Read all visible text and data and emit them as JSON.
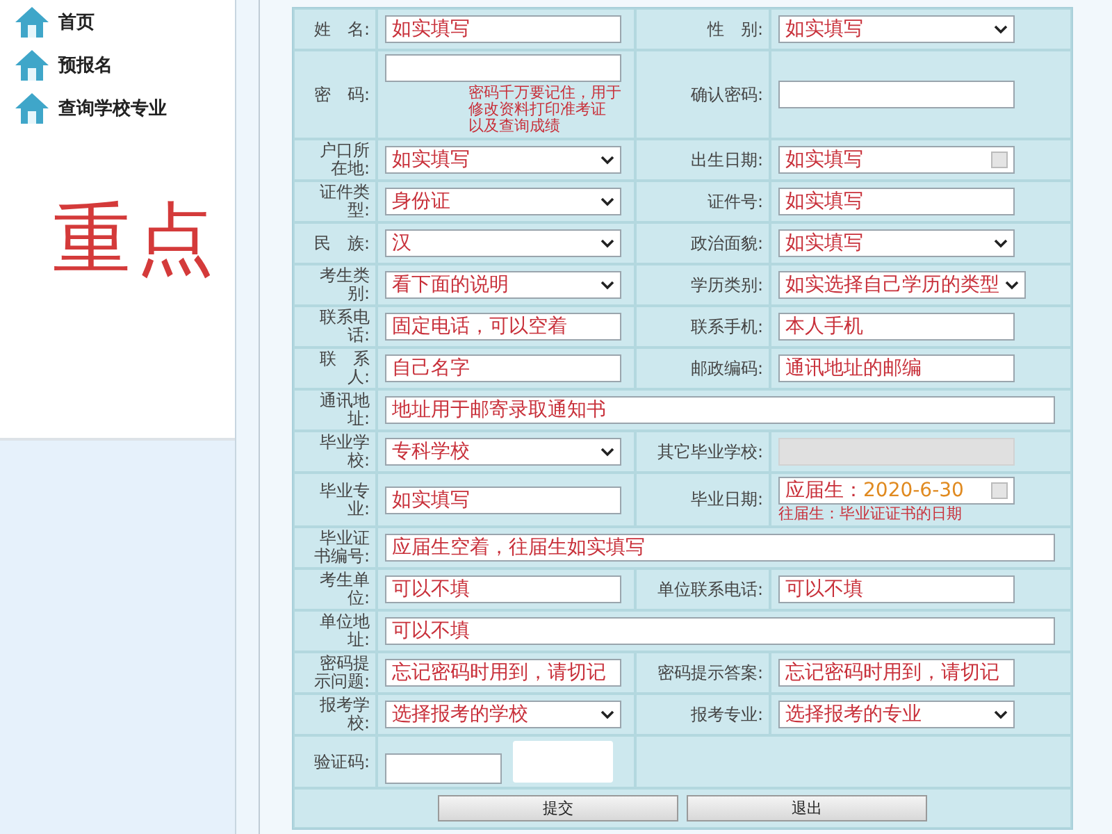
{
  "nav": [
    {
      "label": "首页"
    },
    {
      "label": "预报名"
    },
    {
      "label": "查询学校专业"
    }
  ],
  "stamp": "重点",
  "rows": [
    {
      "cells": [
        {
          "label": "姓　名:",
          "kind": "text",
          "value": "如实填写"
        },
        {
          "label": "性　别:",
          "kind": "select",
          "value": "如实填写"
        }
      ]
    },
    {
      "cells": [
        {
          "label": "密　码:",
          "kind": "text",
          "note": [
            "密码千万要记住，用于",
            "修改资料打印准考证",
            "以及查询成绩"
          ]
        },
        {
          "label": "确认密码:",
          "kind": "text"
        }
      ]
    },
    {
      "cells": [
        {
          "label": "户口所在地:",
          "kind": "select",
          "value": "如实填写"
        },
        {
          "label": "出生日期:",
          "kind": "date",
          "value": "如实填写"
        }
      ]
    },
    {
      "cells": [
        {
          "label": "证件类型:",
          "kind": "select",
          "value": "身份证"
        },
        {
          "label": "证件号:",
          "kind": "text",
          "value": "如实填写"
        }
      ]
    },
    {
      "cells": [
        {
          "label": "民　族:",
          "kind": "select",
          "value": "汉"
        },
        {
          "label": "政治面貌:",
          "kind": "select",
          "value": "如实填写"
        }
      ]
    },
    {
      "cells": [
        {
          "label": "考生类别:",
          "kind": "select",
          "value": "看下面的说明"
        },
        {
          "label": "学历类别:",
          "kind": "select",
          "value": "如实选择自己学历的类型"
        }
      ]
    },
    {
      "cells": [
        {
          "label": "联系电话:",
          "kind": "text",
          "value": "固定电话，可以空着"
        },
        {
          "label": "联系手机:",
          "kind": "text",
          "value": "本人手机"
        }
      ]
    },
    {
      "cells": [
        {
          "label": "联　系人:",
          "kind": "text",
          "value": "自己名字"
        },
        {
          "label": "邮政编码:",
          "kind": "text",
          "value": "通讯地址的邮编"
        }
      ]
    },
    {
      "cells": [
        {
          "label": "通讯地址:",
          "kind": "text",
          "value": "地址用于邮寄录取通知书"
        }
      ]
    },
    {
      "cells": [
        {
          "label": "毕业学校:",
          "kind": "select",
          "value": "专科学校"
        },
        {
          "label": "其它毕业学校:",
          "kind": "text",
          "disabled": true
        }
      ]
    },
    {
      "cells": [
        {
          "label": "毕业专业:",
          "kind": "text",
          "value": "如实填写"
        },
        {
          "label": "毕业日期:",
          "kind": "date",
          "value": "应届生：",
          "highlight": "2020-6-30",
          "note": [
            "往届生：毕业证证书的日期"
          ]
        }
      ]
    },
    {
      "cells": [
        {
          "label": "毕业证书编号:",
          "kind": "text",
          "value": "应届生空着，往届生如实填写"
        }
      ]
    },
    {
      "cells": [
        {
          "label": "考生单位:",
          "kind": "text",
          "value": "可以不填"
        },
        {
          "label": "单位联系电话:",
          "kind": "text",
          "value": "可以不填"
        }
      ]
    },
    {
      "cells": [
        {
          "label": "单位地址:",
          "kind": "text",
          "value": "可以不填"
        }
      ]
    },
    {
      "cells": [
        {
          "label": "密码提示问题:",
          "kind": "text",
          "value": "忘记密码时用到，请切记"
        },
        {
          "label": "密码提示答案:",
          "kind": "text",
          "value": "忘记密码时用到，请切记"
        }
      ]
    },
    {
      "cells": [
        {
          "label": "报考学校:",
          "kind": "select",
          "value": "选择报考的学校"
        },
        {
          "label": "报考专业:",
          "kind": "select",
          "value": "选择报考的专业"
        }
      ]
    },
    {
      "cells": [
        {
          "label": "验证码:",
          "kind": "captcha"
        }
      ]
    }
  ],
  "buttons": [
    "提交",
    "退出"
  ]
}
